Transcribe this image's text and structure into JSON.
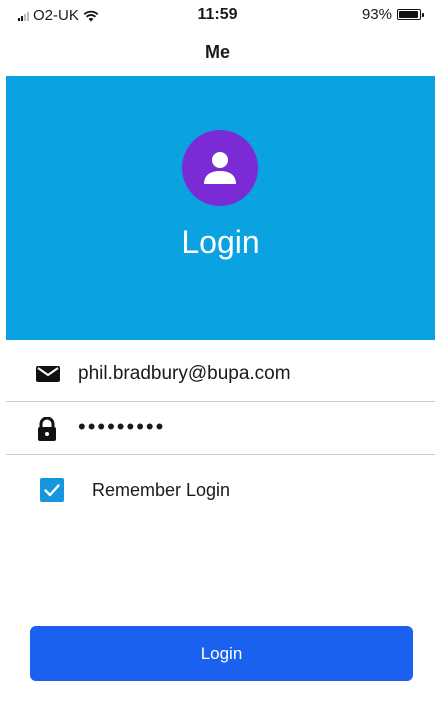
{
  "status_bar": {
    "carrier": "O2-UK",
    "time": "11:59",
    "battery_percent": "93%",
    "battery_level": 0.93,
    "icons": [
      "signal-icon",
      "wifi-icon",
      "battery-icon"
    ]
  },
  "nav": {
    "title": "Me"
  },
  "hero": {
    "title": "Login",
    "avatar_icon": "person-icon",
    "background_color": "#0aa2e0",
    "avatar_color": "#7b2bd6"
  },
  "form": {
    "email": {
      "value": "phil.bradbury@bupa.com",
      "icon": "mail-icon"
    },
    "password": {
      "value": "•••••••••",
      "icon": "lock-icon"
    },
    "remember": {
      "label": "Remember Login",
      "checked": true
    }
  },
  "actions": {
    "login_label": "Login",
    "button_color": "#1a61f0"
  }
}
